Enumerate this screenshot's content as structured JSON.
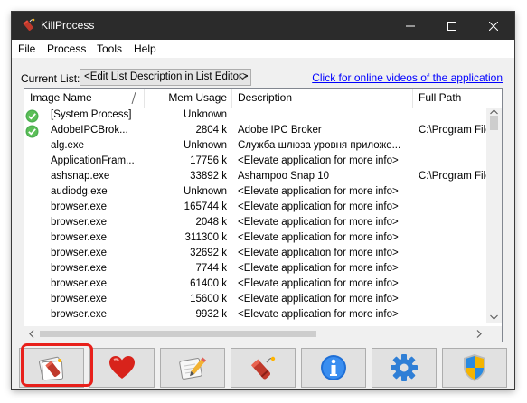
{
  "window": {
    "title": "KillProcess"
  },
  "menu": [
    "File",
    "Process",
    "Tools",
    "Help"
  ],
  "current_list": {
    "label": "Current List:",
    "value": "<Edit List Description in List Editor>"
  },
  "online_link": "Click for online videos of the application",
  "columns": {
    "name": "Image Name",
    "mem": "Mem Usage",
    "desc": "Description",
    "path": "Full Path"
  },
  "rows": [
    {
      "icon": "check",
      "name": "[System Process]",
      "mem": "Unknown",
      "desc": "",
      "path": ""
    },
    {
      "icon": "check",
      "name": "AdobeIPCBrok...",
      "mem": "2804 k",
      "desc": "Adobe IPC Broker",
      "path": "C:\\Program File"
    },
    {
      "icon": "",
      "name": "alg.exe",
      "mem": "Unknown",
      "desc": "Служба шлюза уровня приложе...",
      "path": ""
    },
    {
      "icon": "",
      "name": "ApplicationFram...",
      "mem": "17756 k",
      "desc": "<Elevate application for more info>",
      "path": ""
    },
    {
      "icon": "",
      "name": "ashsnap.exe",
      "mem": "33892 k",
      "desc": "Ashampoo Snap 10",
      "path": "C:\\Program File"
    },
    {
      "icon": "",
      "name": "audiodg.exe",
      "mem": "Unknown",
      "desc": "<Elevate application for more info>",
      "path": ""
    },
    {
      "icon": "",
      "name": "browser.exe",
      "mem": "165744 k",
      "desc": "<Elevate application for more info>",
      "path": ""
    },
    {
      "icon": "",
      "name": "browser.exe",
      "mem": "2048 k",
      "desc": "<Elevate application for more info>",
      "path": ""
    },
    {
      "icon": "",
      "name": "browser.exe",
      "mem": "311300 k",
      "desc": "<Elevate application for more info>",
      "path": ""
    },
    {
      "icon": "",
      "name": "browser.exe",
      "mem": "32692 k",
      "desc": "<Elevate application for more info>",
      "path": ""
    },
    {
      "icon": "",
      "name": "browser.exe",
      "mem": "7744 k",
      "desc": "<Elevate application for more info>",
      "path": ""
    },
    {
      "icon": "",
      "name": "browser.exe",
      "mem": "61400 k",
      "desc": "<Elevate application for more info>",
      "path": ""
    },
    {
      "icon": "",
      "name": "browser.exe",
      "mem": "15600 k",
      "desc": "<Elevate application for more info>",
      "path": ""
    },
    {
      "icon": "",
      "name": "browser.exe",
      "mem": "9932 k",
      "desc": "<Elevate application for more info>",
      "path": ""
    }
  ],
  "toolbar": [
    {
      "icon": "kill-process-icon",
      "highlighted": true
    },
    {
      "icon": "heart-icon"
    },
    {
      "icon": "list-editor-icon"
    },
    {
      "icon": "dynamite-icon"
    },
    {
      "icon": "info-icon"
    },
    {
      "icon": "settings-gear-icon"
    },
    {
      "icon": "uac-shield-icon"
    }
  ],
  "colors": {
    "titlebar": "#2b2b2b",
    "link": "#0000ff",
    "highlight": "#e8201b"
  }
}
